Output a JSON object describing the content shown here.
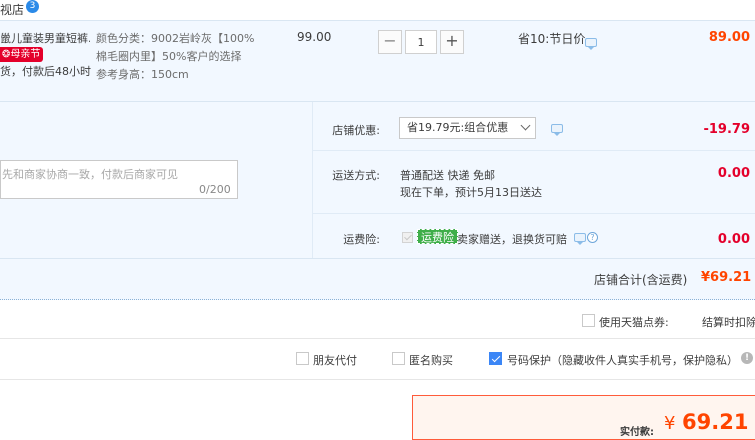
{
  "header": {
    "shop_link": "视店",
    "badge": "3"
  },
  "item": {
    "title": "巤儿童装男童短裤...",
    "promo_tag": "母亲节",
    "ship_time": "货，付款后48小时",
    "sku_line1": "颜色分类：9002岩岭灰【100%",
    "sku_line2": "棉毛圈内里】50%客户的选择",
    "sku_line3": "参考身高：150cm",
    "unit_price": "99.00",
    "quantity": "1",
    "qty_minus": "−",
    "qty_plus": "+",
    "discount": "省10:节日价",
    "total": "89.00"
  },
  "message": {
    "placeholder": "先和商家协商一致，付款后商家可见",
    "count": "0/200"
  },
  "coupon": {
    "label": "店铺优惠:",
    "selected": "省19.79元:组合优惠",
    "amount": "-19.79"
  },
  "shipping": {
    "label": "运送方式:",
    "line1": "普通配送 快递 免邮",
    "line2": "现在下单，预计5月13日送达",
    "amount": "0.00"
  },
  "insurance": {
    "label": "运费险:",
    "tag": "运费险",
    "text": "卖家赠送，退换货可赔",
    "amount": "0.00"
  },
  "subtotal": {
    "label": "店铺合计(含运费)",
    "value": "¥69.21"
  },
  "tmall": {
    "coupon_label": "使用天猫点券:",
    "settle_text": "结算时扣除"
  },
  "options": {
    "friend_pay": "朋友代付",
    "anonymous": "匿名购买",
    "number_protect": "号码保护（隐藏收件人真实手机号，保护隐私）"
  },
  "payment": {
    "label": "实付款:",
    "currency": "¥",
    "value": "69.21"
  },
  "colors": {
    "accent": "#ff4400",
    "red": "#e4002b",
    "panel": "#f2f8ff",
    "check_blue": "#3b86f6"
  }
}
